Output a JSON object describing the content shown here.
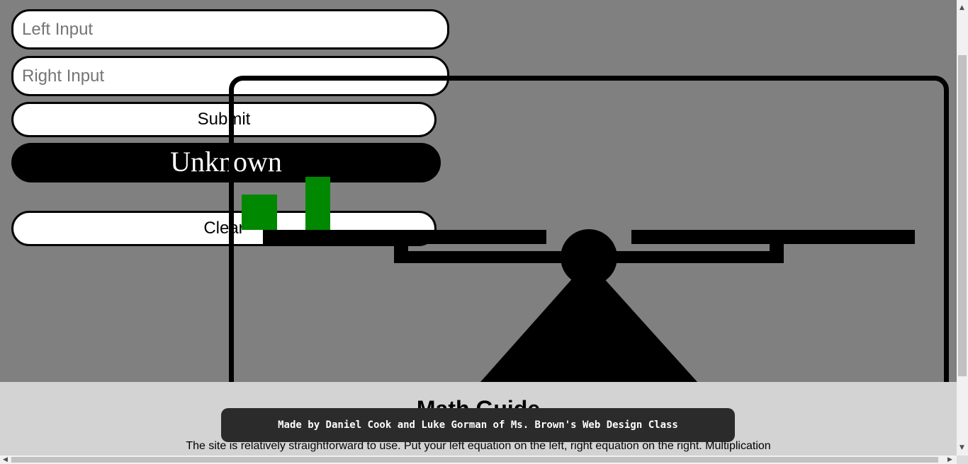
{
  "form": {
    "left_input_placeholder": "Left Input",
    "right_input_placeholder": "Right Input",
    "submit_label": "Submit",
    "result_label": "Unknown",
    "clear_label": "Clear"
  },
  "scale": {
    "left_weights": [
      1,
      1
    ],
    "right_weights": [],
    "colors": {
      "weight": "#008800",
      "beam": "#000000",
      "background": "#808080"
    }
  },
  "guide": {
    "title": "Math Guide",
    "text": "The site is relatively straightforward to use. Put your left equation on the left, right equation on the right. Multiplication"
  },
  "credit": "Made by Daniel Cook and Luke Gorman of Ms. Brown's Web Design Class",
  "scrollbars": {
    "up_icon": "▲",
    "down_icon": "▼",
    "left_icon": "◀",
    "right_icon": "▶"
  }
}
